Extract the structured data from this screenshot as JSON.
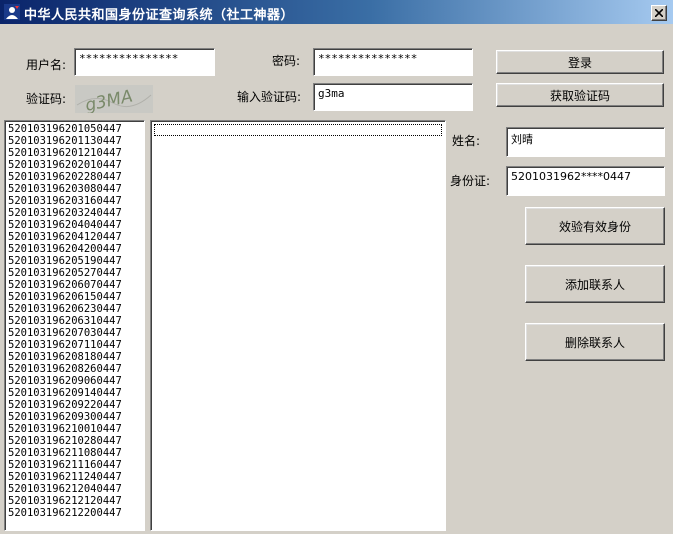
{
  "window": {
    "title": "中华人民共和国身份证查询系统（社工神器）"
  },
  "login": {
    "username_label": "用户名:",
    "username_value": "***************",
    "password_label": "密码:",
    "password_value": "***************",
    "login_button": "登录",
    "captcha_label": "验证码:",
    "captcha_image_text": "g3MA",
    "captcha_input_label": "输入验证码:",
    "captcha_input_value": "g3ma",
    "get_captcha_button": "获取验证码"
  },
  "id_list": [
    "520103196201050447",
    "520103196201130447",
    "520103196201210447",
    "520103196202010447",
    "520103196202280447",
    "520103196203080447",
    "520103196203160447",
    "520103196203240447",
    "520103196204040447",
    "520103196204120447",
    "520103196204200447",
    "520103196205190447",
    "520103196205270447",
    "520103196206070447",
    "520103196206150447",
    "520103196206230447",
    "520103196206310447",
    "520103196207030447",
    "520103196207110447",
    "520103196208180447",
    "520103196208260447",
    "520103196209060447",
    "520103196209140447",
    "520103196209220447",
    "520103196209300447",
    "520103196210010447",
    "520103196210280447",
    "520103196211080447",
    "520103196211160447",
    "520103196211240447",
    "520103196212040447",
    "520103196212120447",
    "520103196212200447"
  ],
  "details": {
    "name_label": "姓名:",
    "name_value": "刘晴",
    "id_label": "身份证:",
    "id_value": "52010319​62****0447",
    "validate_button": "效验有效身份",
    "add_contact_button": "添加联系人",
    "delete_contact_button": "删除联系人"
  }
}
